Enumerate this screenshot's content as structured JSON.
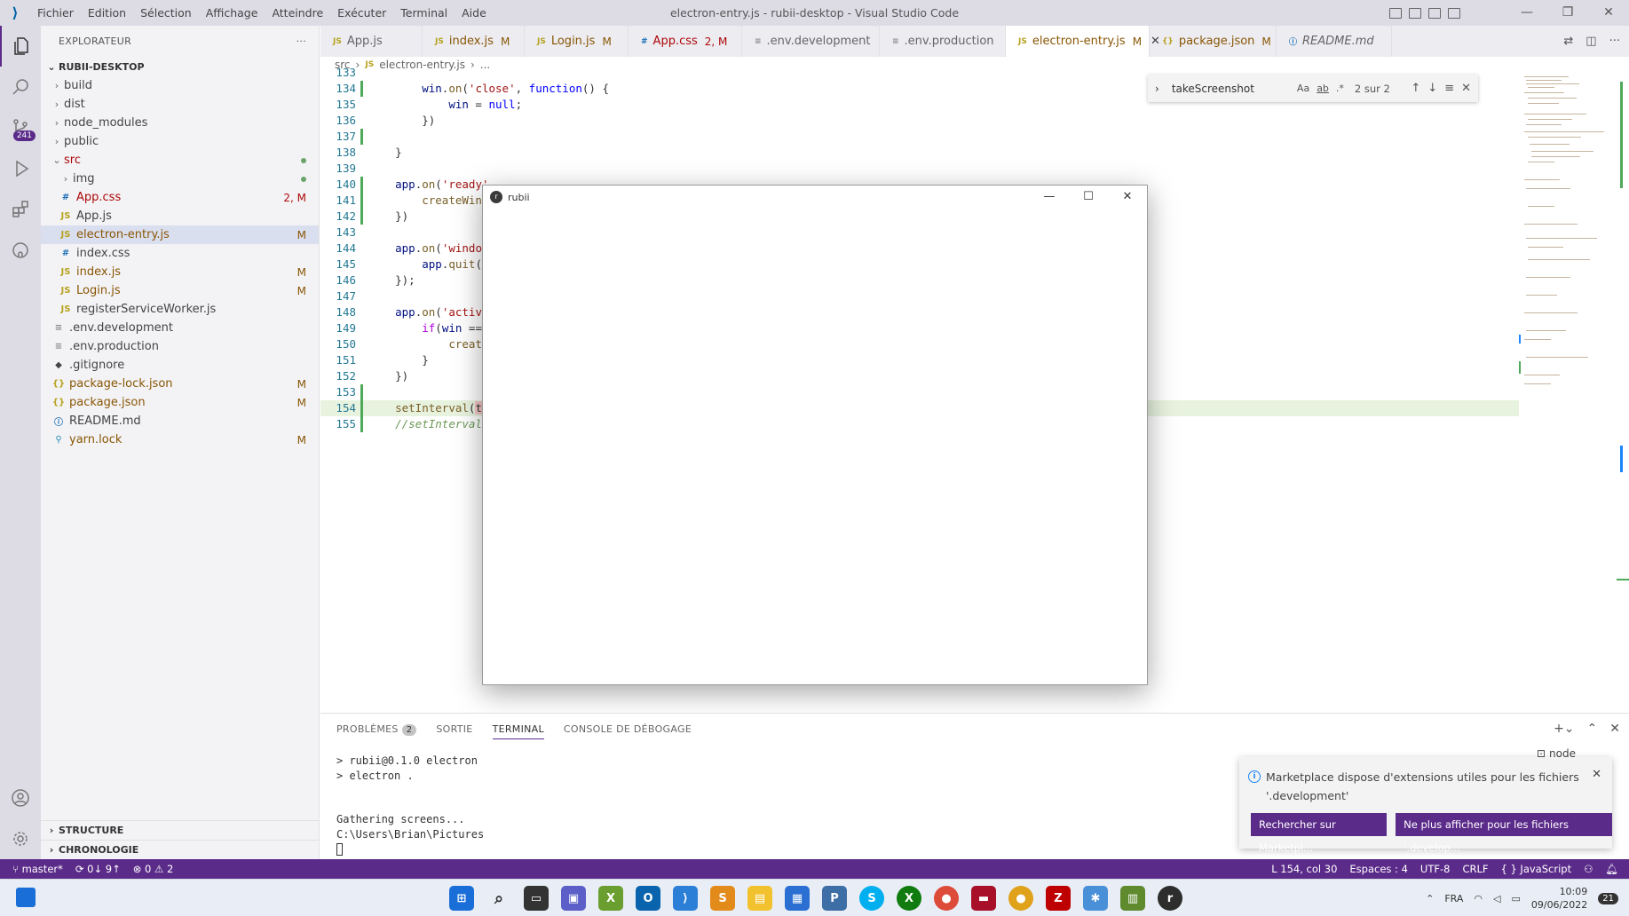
{
  "titlebar": {
    "menu": [
      "Fichier",
      "Edition",
      "Sélection",
      "Affichage",
      "Atteindre",
      "Exécuter",
      "Terminal",
      "Aide"
    ],
    "title": "electron-entry.js - rubii-desktop - Visual Studio Code"
  },
  "activity": {
    "scm_badge": "241"
  },
  "sidebar": {
    "title": "EXPLORATEUR",
    "more": "···",
    "root": "RUBII-DESKTOP",
    "items": [
      {
        "label": "build",
        "deco": ""
      },
      {
        "label": "dist",
        "deco": ""
      },
      {
        "label": "node_modules",
        "deco": ""
      },
      {
        "label": "public",
        "deco": ""
      },
      {
        "label": "src",
        "deco": ""
      },
      {
        "label": "img",
        "deco": ""
      },
      {
        "label": "App.css",
        "deco": "2, M",
        "icon": "#"
      },
      {
        "label": "App.js",
        "deco": "",
        "icon": "JS"
      },
      {
        "label": "electron-entry.js",
        "deco": "M",
        "icon": "JS"
      },
      {
        "label": "index.css",
        "deco": "",
        "icon": "#"
      },
      {
        "label": "index.js",
        "deco": "M",
        "icon": "JS"
      },
      {
        "label": "Login.js",
        "deco": "M",
        "icon": "JS"
      },
      {
        "label": "registerServiceWorker.js",
        "deco": "",
        "icon": "JS"
      },
      {
        "label": ".env.development",
        "deco": "",
        "icon": "≡"
      },
      {
        "label": ".env.production",
        "deco": "",
        "icon": "≡"
      },
      {
        "label": ".gitignore",
        "deco": "",
        "icon": "◆"
      },
      {
        "label": "package-lock.json",
        "deco": "M",
        "icon": "{}"
      },
      {
        "label": "package.json",
        "deco": "M",
        "icon": "{}"
      },
      {
        "label": "README.md",
        "deco": "",
        "icon": "ⓘ"
      },
      {
        "label": "yarn.lock",
        "deco": "M",
        "icon": "⚲"
      }
    ],
    "outline": "STRUCTURE",
    "timeline": "CHRONOLOGIE"
  },
  "tabs": [
    {
      "label": "App.js",
      "icon": "JS",
      "mod": ""
    },
    {
      "label": "index.js",
      "icon": "JS",
      "mod": "M"
    },
    {
      "label": "Login.js",
      "icon": "JS",
      "mod": "M"
    },
    {
      "label": "App.css",
      "icon": "#",
      "mod": "2, M"
    },
    {
      "label": ".env.development",
      "icon": "≡",
      "mod": ""
    },
    {
      "label": ".env.production",
      "icon": "≡",
      "mod": ""
    },
    {
      "label": "electron-entry.js",
      "icon": "JS",
      "mod": "M"
    },
    {
      "label": "package.json",
      "icon": "{}",
      "mod": "M"
    },
    {
      "label": "README.md",
      "icon": "ⓘ",
      "mod": ""
    }
  ],
  "breadcrumb": {
    "folder": "src",
    "file": "electron-entry.js",
    "more": "..."
  },
  "editor": {
    "lines": [
      {
        "n": "133",
        "text": ""
      },
      {
        "n": "134",
        "text": "        win.on('close', function() {"
      },
      {
        "n": "135",
        "text": "            win = null;"
      },
      {
        "n": "136",
        "text": "        })"
      },
      {
        "n": "137",
        "text": ""
      },
      {
        "n": "138",
        "text": "    }"
      },
      {
        "n": "139",
        "text": ""
      },
      {
        "n": "140",
        "text": "    app.on('ready', "
      },
      {
        "n": "141",
        "text": "        createWindow"
      },
      {
        "n": "142",
        "text": "    })"
      },
      {
        "n": "143",
        "text": ""
      },
      {
        "n": "144",
        "text": "    app.on('window-a"
      },
      {
        "n": "145",
        "text": "        app.quit();"
      },
      {
        "n": "146",
        "text": "    });"
      },
      {
        "n": "147",
        "text": ""
      },
      {
        "n": "148",
        "text": "    app.on('activate"
      },
      {
        "n": "149",
        "text": "        if(win == nu"
      },
      {
        "n": "150",
        "text": "            createWi"
      },
      {
        "n": "151",
        "text": "        }"
      },
      {
        "n": "152",
        "text": "    })"
      },
      {
        "n": "153",
        "text": ""
      },
      {
        "n": "154",
        "text": "    setInterval(take"
      },
      {
        "n": "155",
        "text": "    //setInterval(di"
      }
    ]
  },
  "find": {
    "query": "takeScreenshot",
    "case": "Aa",
    "word": "ab",
    "regex": ".*",
    "count": "2 sur 2"
  },
  "popup": {
    "title": "rubii"
  },
  "panel": {
    "tabs": [
      "PROBLÈMES",
      "SORTIE",
      "TERMINAL",
      "CONSOLE DE DÉBOGAGE"
    ],
    "problems_count": "2",
    "terminal_name": "node",
    "terminal_lines": [
      "> rubii@0.1.0 electron",
      "> electron .",
      "",
      "",
      "Gathering screens...",
      "C:\\Users\\Brian\\Pictures"
    ]
  },
  "notification": {
    "message": "Marketplace dispose d'extensions utiles pour les fichiers '.development'",
    "btn_search": "Rechercher sur Marketpl...",
    "btn_dismiss": "Ne plus afficher pour les fichiers '.develop..."
  },
  "status": {
    "branch": "master*",
    "sync": "0↓ 9↑",
    "errors": "⊗ 0 ⚠ 2",
    "position": "L 154, col 30",
    "spaces": "Espaces : 4",
    "encoding": "UTF-8",
    "eol": "CRLF",
    "language": "{ } JavaScript"
  },
  "taskbar": {
    "lang": "FRA",
    "time": "10:09",
    "date": "09/06/2022",
    "notif_count": "21"
  },
  "colors": {
    "accent": "#5b2b8a",
    "modified": "#895503",
    "error": "#ad0707"
  }
}
